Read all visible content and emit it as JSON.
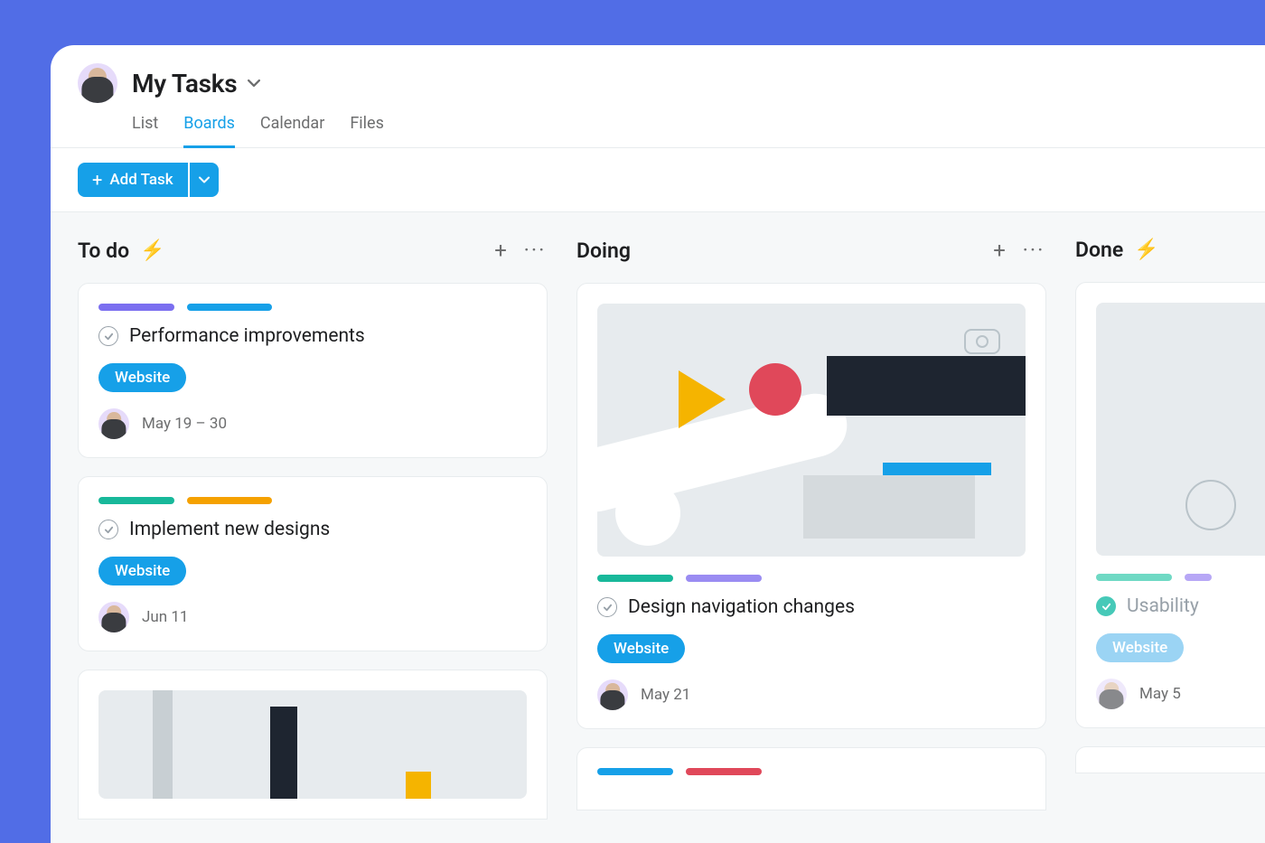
{
  "header": {
    "title": "My Tasks",
    "tabs": [
      "List",
      "Boards",
      "Calendar",
      "Files"
    ],
    "active_tab_index": 1
  },
  "toolbar": {
    "add_task_label": "Add Task"
  },
  "columns": [
    {
      "title": "To do",
      "has_bolt": true,
      "cards": [
        {
          "pills": [
            "#7b6ff0",
            "#16a0e8"
          ],
          "pill_widths": [
            84,
            94
          ],
          "title": "Performance improvements",
          "completed": false,
          "tag": "Website",
          "date": "May 19 – 30"
        },
        {
          "pills": [
            "#18b e?"
          ],
          "_pills_actual": true,
          "pills2": [
            "#18b89a",
            "#f5a100"
          ],
          "pill_widths2": [
            84,
            94
          ],
          "title": "Implement new designs",
          "completed": false,
          "tag": "Website",
          "date": "Jun 11"
        }
      ]
    },
    {
      "title": "Doing",
      "has_bolt": false,
      "cards": [
        {
          "has_cover": true,
          "pills": [
            "#18b89a",
            "#9a8cf2"
          ],
          "pill_widths": [
            84,
            84
          ],
          "title": "Design navigation changes",
          "completed": false,
          "tag": "Website",
          "date": "May 21"
        }
      ],
      "peek_pills": [
        "#16a0e8",
        "#e0485a"
      ]
    },
    {
      "title": "Done",
      "has_bolt": true,
      "cards": [
        {
          "has_cover2": true,
          "pills": [
            "#6fd9c4",
            "#b7a7f6"
          ],
          "pill_widths": [
            84,
            30
          ],
          "title": "Usability",
          "completed": true,
          "tag": "Website",
          "tag_muted": true,
          "date": "May 5"
        }
      ]
    }
  ],
  "colors": {
    "brand_blue": "#16a0e8",
    "bg_outer": "#516de6"
  }
}
